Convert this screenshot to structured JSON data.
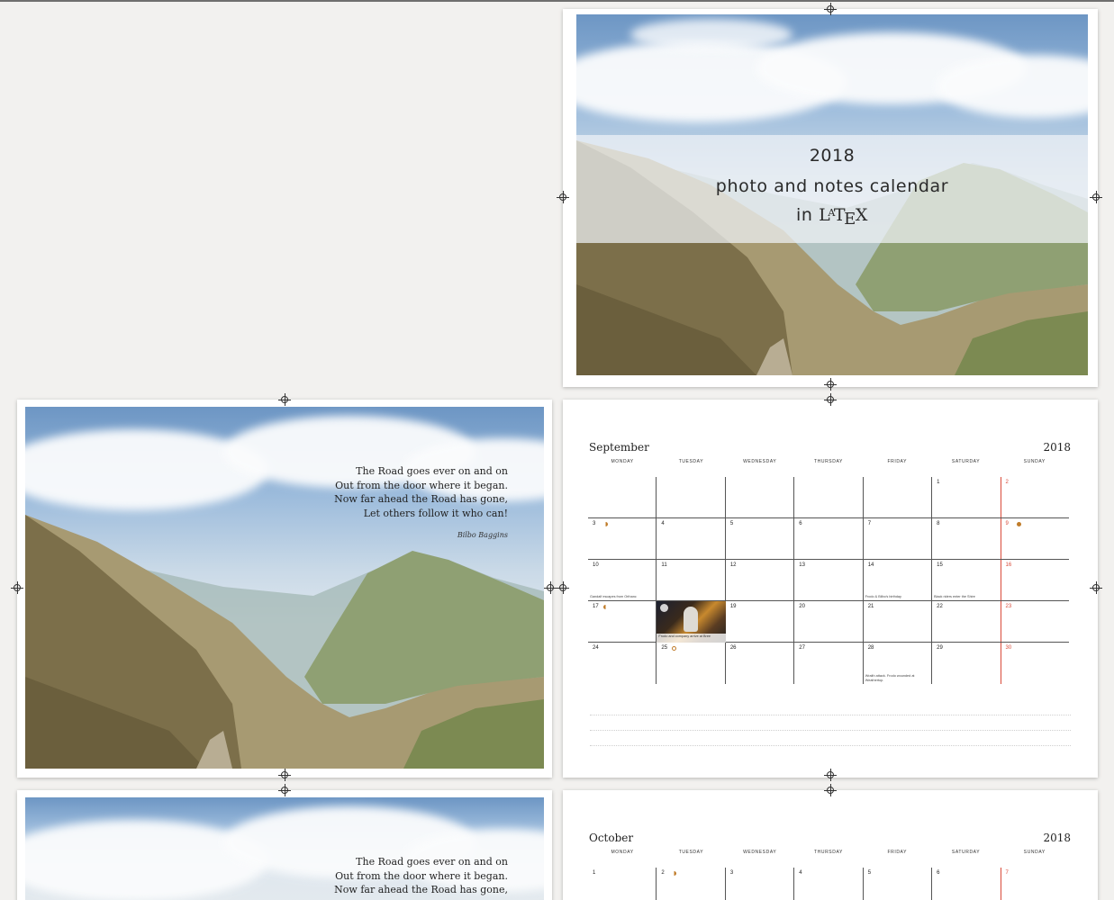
{
  "cover": {
    "line1": "2018",
    "line2": "photo and notes calendar",
    "line3_prefix": "in",
    "latex_logo": "LaTeX"
  },
  "poem": {
    "lines": [
      "The Road goes ever on and on",
      "Out from the door where it began.",
      "Now far ahead the Road has gone,",
      "Let others follow it who can!"
    ],
    "author": "Bilbo Baggins"
  },
  "september": {
    "month": "September",
    "year": "2018",
    "days_of_week": [
      "MONDAY",
      "TUESDAY",
      "WEDNESDAY",
      "THURSDAY",
      "FRIDAY",
      "SATURDAY",
      "SUNDAY"
    ],
    "weeks": [
      [
        "",
        "",
        "",
        "",
        "",
        "1",
        "2"
      ],
      [
        "3",
        "4",
        "5",
        "6",
        "7",
        "8",
        "9"
      ],
      [
        "10",
        "11",
        "12",
        "13",
        "14",
        "15",
        "16"
      ],
      [
        "17",
        "",
        "19",
        "20",
        "21",
        "22",
        "23"
      ],
      [
        "24",
        "25",
        "26",
        "27",
        "28",
        "29",
        "30"
      ]
    ],
    "notes": {
      "sep10": "Gandalf escapes from Orthanc",
      "sep14": "Frodo & Bilbo's birthday",
      "sep15": "Black riders enter the Shire",
      "sep18": "Frodo and company arrive at Bree",
      "sep28": "Wraith attack. Frodo wounded at Weathertop."
    }
  },
  "october": {
    "month": "October",
    "year": "2018",
    "days_of_week": [
      "MONDAY",
      "TUESDAY",
      "WEDNESDAY",
      "THURSDAY",
      "FRIDAY",
      "SATURDAY",
      "SUNDAY"
    ],
    "week1": [
      "1",
      "2",
      "3",
      "4",
      "5",
      "6",
      "7"
    ]
  },
  "colors": {
    "sunday_red": "#d94b3a",
    "moon_orange": "#c07c2a"
  }
}
